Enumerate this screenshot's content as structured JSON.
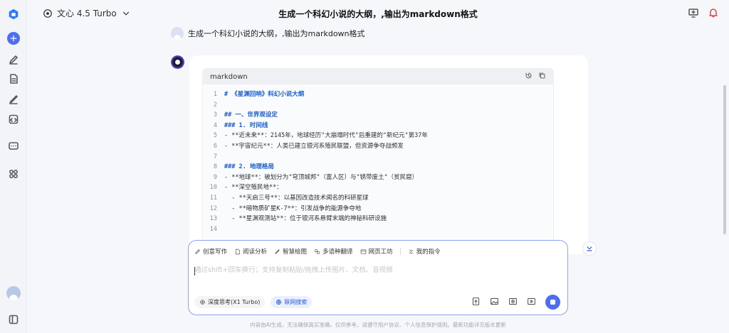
{
  "header": {
    "model_name": "文心 4.5 Turbo",
    "title": "生成一个科幻小说的大纲，,输出为markdown格式",
    "icons": [
      "screen-share-icon",
      "bell-icon"
    ]
  },
  "sidebar": {
    "icons": [
      "logo-icon",
      "new-chat-icon",
      "edit-icon",
      "document-icon",
      "pen-icon",
      "code-icon",
      "chat-icon",
      "apps-icon",
      "user-avatar",
      "panel-toggle-icon"
    ]
  },
  "conversation": {
    "user_message": "生成一个科幻小说的大纲，,输出为markdown格式",
    "code_block": {
      "language": "markdown",
      "lines": [
        {
          "n": "1",
          "text": "# 《星渊回响》科幻小说大纲"
        },
        {
          "n": "2",
          "text": ""
        },
        {
          "n": "3",
          "text": "## 一、世界观设定"
        },
        {
          "n": "4",
          "text": "### 1. 时间线"
        },
        {
          "n": "5",
          "text": "- **近未来**：2145年，地球经历\"大崩塌时代\"后重建的\"新纪元\"第37年"
        },
        {
          "n": "6",
          "text": "- **宇宙纪元**：人类已建立银河系殖民联盟，但资源争夺战频发"
        },
        {
          "n": "7",
          "text": ""
        },
        {
          "n": "8",
          "text": "### 2. 地理格局"
        },
        {
          "n": "9",
          "text": "- **地球**：被划分为\"穹顶城邦\"（富人区）与\"锈带废土\"（贫民窟）"
        },
        {
          "n": "10",
          "text": "- **深空殖民地**："
        },
        {
          "n": "11",
          "text": "  - **天启三号**：以基因改造技术闻名的科研星球"
        },
        {
          "n": "12",
          "text": "  - **暗物质矿星K-7**：引发战争的能源争夺地"
        },
        {
          "n": "13",
          "text": "  - **星渊观测站**：位于银河系悬臂末端的神秘科研设施"
        },
        {
          "n": "14",
          "text": ""
        }
      ]
    }
  },
  "input": {
    "tools": [
      "创意写作",
      "阅读分析",
      "智慧绘图",
      "多语种翻译",
      "网页工坊",
      "我的指令"
    ],
    "placeholder": "通过shift+回车换行；支持复制粘贴/拖拽上传图片、文档、音视频",
    "chip_deep_think": "深度思考(X1 Turbo)",
    "chip_web_search": "联网搜索"
  },
  "footer": {
    "disclaimer": "内容由AI生成，无法确保真实准确，仅供参考。请遵守用户协议、个人信息保护规则。最新功能详见版本更新"
  },
  "colors": {
    "accent": "#4e6ef2",
    "heading_blue": "#1a5fd0",
    "notification_red": "#e54545"
  }
}
